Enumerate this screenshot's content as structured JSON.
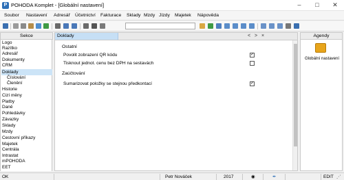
{
  "window": {
    "title": "POHODA Komplet - [Globální nastavení]",
    "app_icon": "P",
    "controls": [
      "minimize-icon",
      "maximize-icon",
      "close-icon"
    ]
  },
  "menu": [
    "Soubor",
    "Nastavení",
    "Adresář",
    "Účetnictví",
    "Fakturace",
    "Sklady",
    "Mzdy",
    "Jízdy",
    "Majetek",
    "Nápověda"
  ],
  "toolbar": {
    "search_value": "",
    "icons": [
      "menu-icon",
      "cut-icon",
      "copy-icon",
      "paste-icon",
      "refresh-icon",
      "checkmark-icon",
      "arrow-icon",
      "arrow-left-icon",
      "arrow-right-icon",
      "save-icon",
      "print-icon",
      "folder-icon",
      "green-leaf-icon",
      "filter-icon",
      "grid-icon",
      "list-icon",
      "table-icon",
      "calculator-icon",
      "columns-icon",
      "settings-icon",
      "help-icon"
    ]
  },
  "sidebar": {
    "header": "Sekce",
    "items": [
      {
        "label": "Logo",
        "sub": false
      },
      {
        "label": "Razítko",
        "sub": false
      },
      {
        "label": "Adresář",
        "sub": false
      },
      {
        "label": "Dokumenty",
        "sub": false
      },
      {
        "label": "CRM",
        "sub": false
      },
      {
        "label": "Doklady",
        "sub": false,
        "selected": true
      },
      {
        "label": "Číslování",
        "sub": true
      },
      {
        "label": "Členění",
        "sub": true
      },
      {
        "label": "Historie",
        "sub": false
      },
      {
        "label": "Cizí měny",
        "sub": false
      },
      {
        "label": "Platby",
        "sub": false
      },
      {
        "label": "Daně",
        "sub": false
      },
      {
        "label": "Pohledávky",
        "sub": false
      },
      {
        "label": "Závazky",
        "sub": false
      },
      {
        "label": "Sklady",
        "sub": false
      },
      {
        "label": "Mzdy",
        "sub": false
      },
      {
        "label": "Cestovní příkazy",
        "sub": false
      },
      {
        "label": "Majetek",
        "sub": false
      },
      {
        "label": "Centrála",
        "sub": false
      },
      {
        "label": "Intrastat",
        "sub": false
      },
      {
        "label": "mPOHODA",
        "sub": false
      },
      {
        "label": "EET",
        "sub": false
      }
    ]
  },
  "content": {
    "tab": "Doklady",
    "nav_prev": "<",
    "nav_next": ">",
    "close": "×",
    "sections": [
      {
        "title": "Ostatní",
        "options": [
          {
            "label": "Povolit zobrazení QR kódu",
            "checked": true,
            "mark": "✓"
          },
          {
            "label": "Tisknout jednot. cenu bez DPH na sestavách",
            "checked": false,
            "mark": ""
          }
        ]
      },
      {
        "title": "Zaúčtování",
        "options": [
          {
            "label": "Sumarizovat položky se stejnou předkontací",
            "checked": true,
            "mark": "✓"
          }
        ]
      }
    ]
  },
  "agendy": {
    "header": "Agendy",
    "item_label": "Globální nastavení",
    "item_icon": "global-settings-icon"
  },
  "status": {
    "left": "OK",
    "user": "Petr Nováček",
    "year": "2017",
    "mode": "EDIT"
  }
}
